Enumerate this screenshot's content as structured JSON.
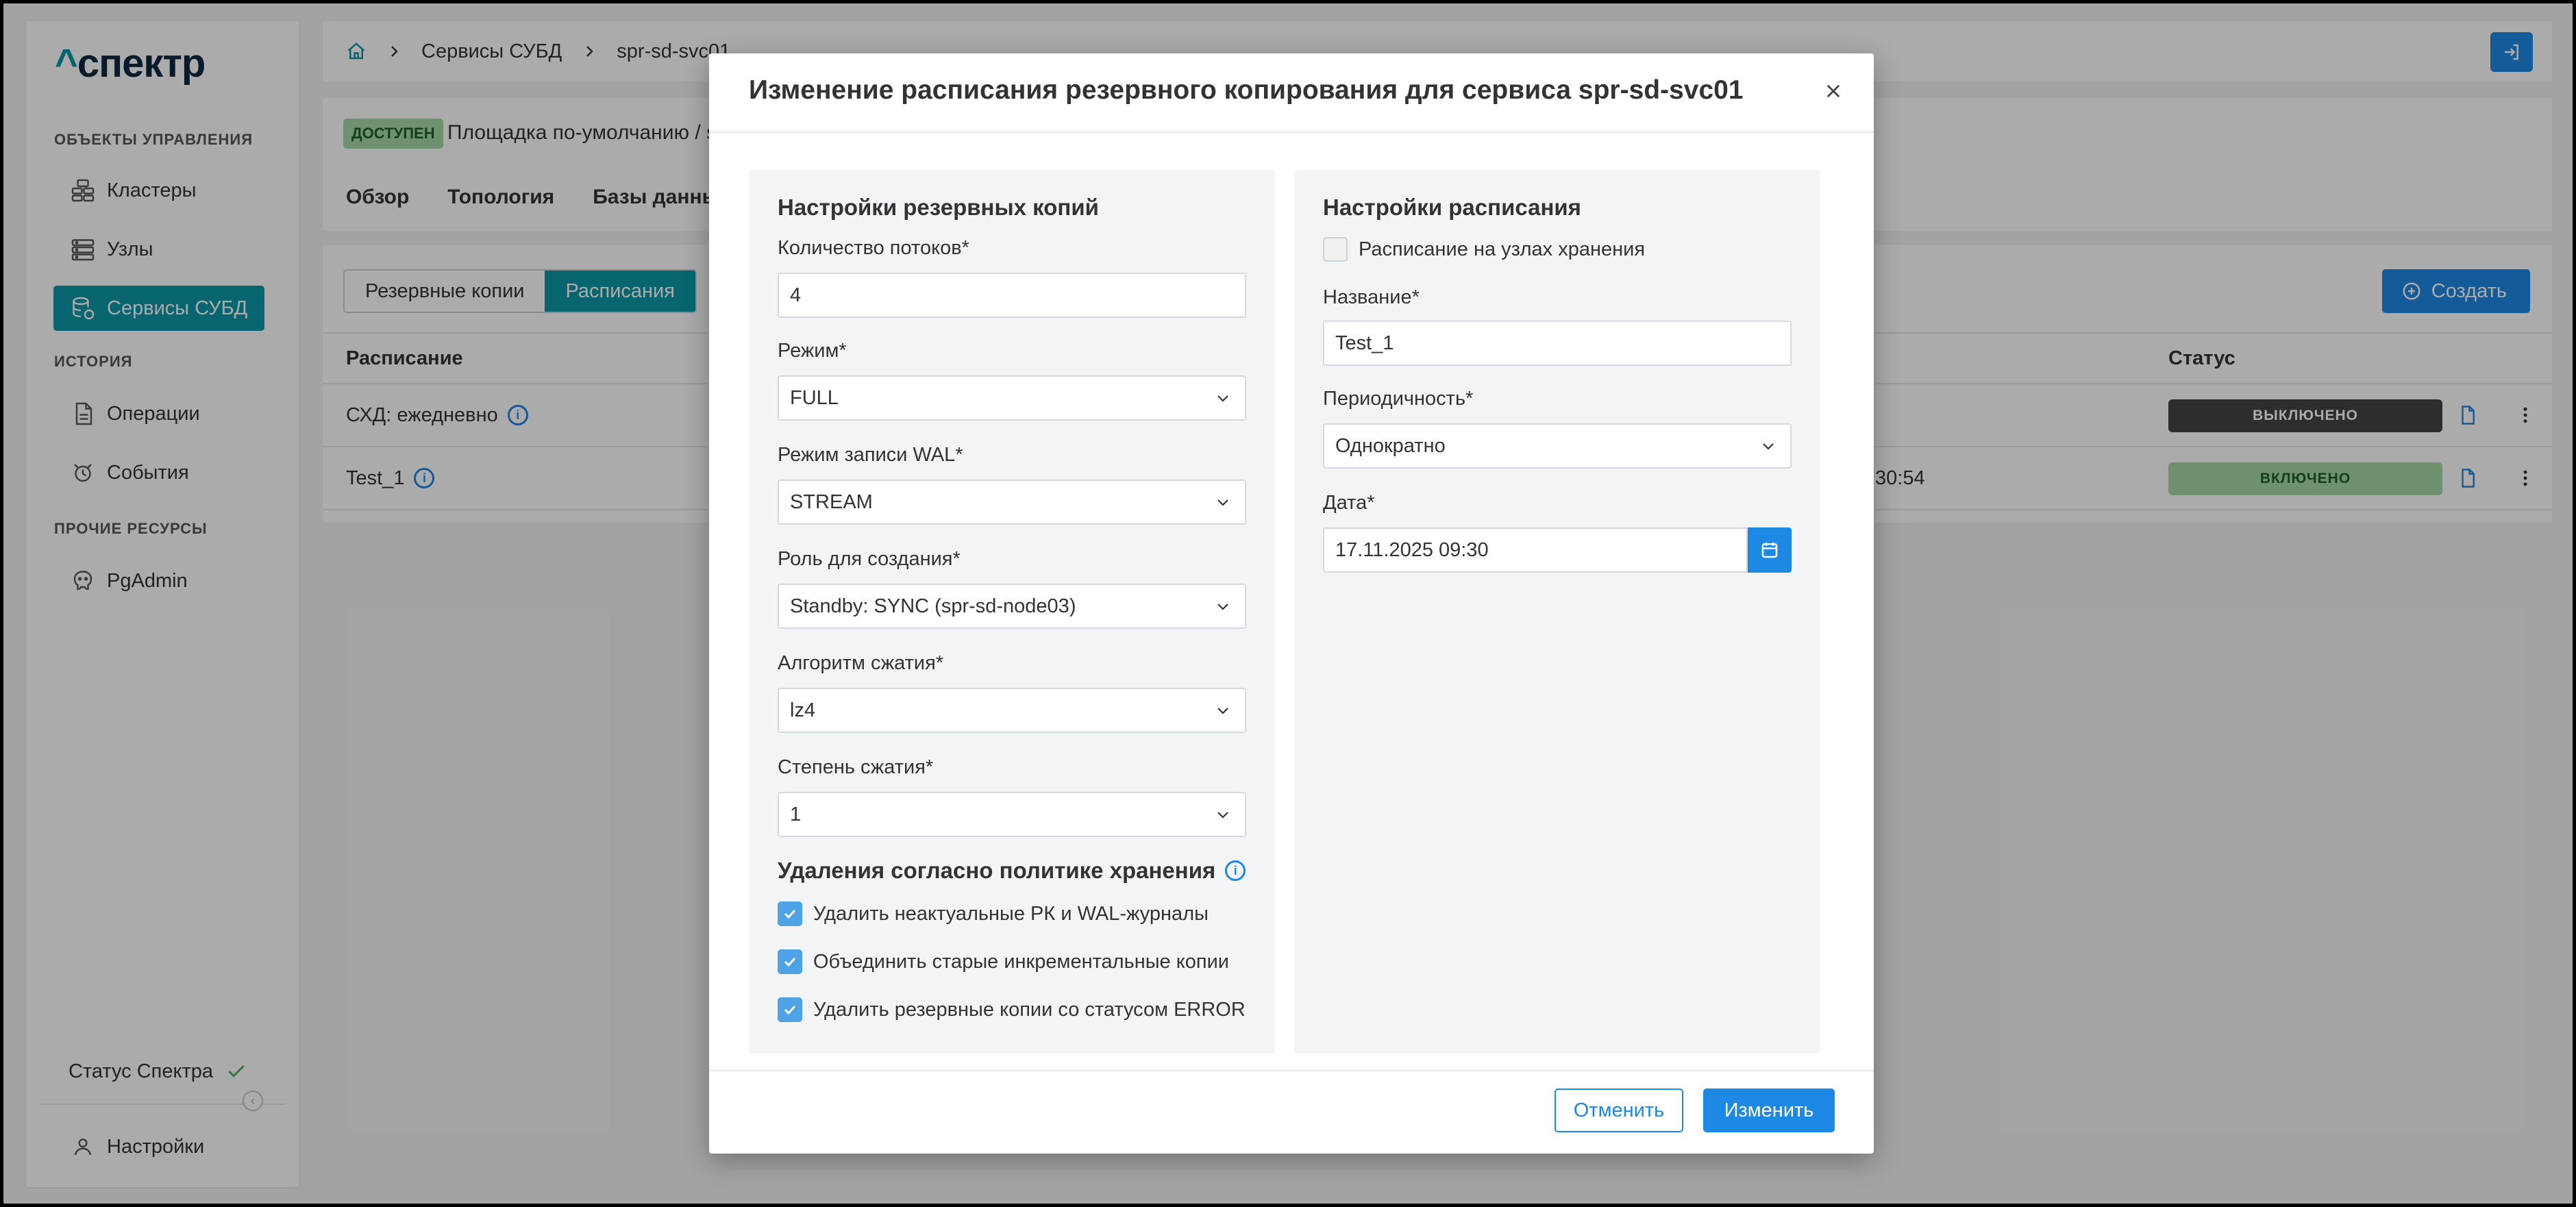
{
  "colors": {
    "accent": "#1e88e5",
    "teal": "#0b97a6",
    "success": "#a8d9a8",
    "disabled": "#444444"
  },
  "sidebar": {
    "logo": "спектр",
    "sections": {
      "management": "ОБЪЕКТЫ УПРАВЛЕНИЯ",
      "history": "ИСТОРИЯ",
      "other": "ПРОЧИЕ РЕСУРСЫ"
    },
    "items": {
      "clusters": "Кластеры",
      "nodes": "Узлы",
      "dbms": "Сервисы СУБД",
      "operations": "Операции",
      "events": "События",
      "pgadmin": "PgAdmin"
    },
    "status": "Статус Спектра",
    "settings": "Настройки"
  },
  "breadcrumb": {
    "section": "Сервисы СУБД",
    "current": "spr-sd-svc01"
  },
  "service": {
    "status_badge": "ДОСТУПЕН",
    "path": "Площадка по-умолчанию /  s",
    "tabs": {
      "overview": "Обзор",
      "topology": "Топология",
      "databases": "Базы данных"
    }
  },
  "schedules": {
    "segments": {
      "backups": "Резервные копии",
      "schedules": "Расписания"
    },
    "create_label": "Создать",
    "columns": {
      "schedule": "Расписание",
      "status": "Статус"
    },
    "rows": [
      {
        "name": "СХД: ежедневно",
        "extra": "",
        "status": "ВЫКЛЮЧЕНО"
      },
      {
        "name": "Test_1",
        "extra": "30:54",
        "status": "ВКЛЮЧЕНО"
      }
    ]
  },
  "modal": {
    "title": "Изменение расписания резервного копирования для сервиса spr-sd-svc01",
    "backup": {
      "title": "Настройки резервных копий",
      "threads": {
        "label": "Количество потоков*",
        "value": "4"
      },
      "mode": {
        "label": "Режим*",
        "value": "FULL"
      },
      "wal_mode": {
        "label": "Режим записи WAL*",
        "value": "STREAM"
      },
      "role": {
        "label": "Роль для создания*",
        "value": "Standby: SYNC (spr-sd-node03)"
      },
      "algorithm": {
        "label": "Алгоритм сжатия*",
        "value": "lz4"
      },
      "level": {
        "label": "Степень сжатия*",
        "value": "1"
      },
      "retention": {
        "title": "Удаления согласно политике хранения",
        "options": [
          "Удалить неактуальные РК и WAL-журналы",
          "Объединить старые инкрементальные копии",
          "Удалить резервные копии со статусом ERROR"
        ]
      }
    },
    "schedule": {
      "title": "Настройки расписания",
      "on_storage_label": "Расписание на узлах хранения",
      "name": {
        "label": "Название*",
        "value": "Test_1"
      },
      "periodicity": {
        "label": "Периодичность*",
        "value": "Однократно"
      },
      "date": {
        "label": "Дата*",
        "value": "17.11.2025 09:30"
      }
    },
    "cancel_label": "Отменить",
    "apply_label": "Изменить"
  }
}
